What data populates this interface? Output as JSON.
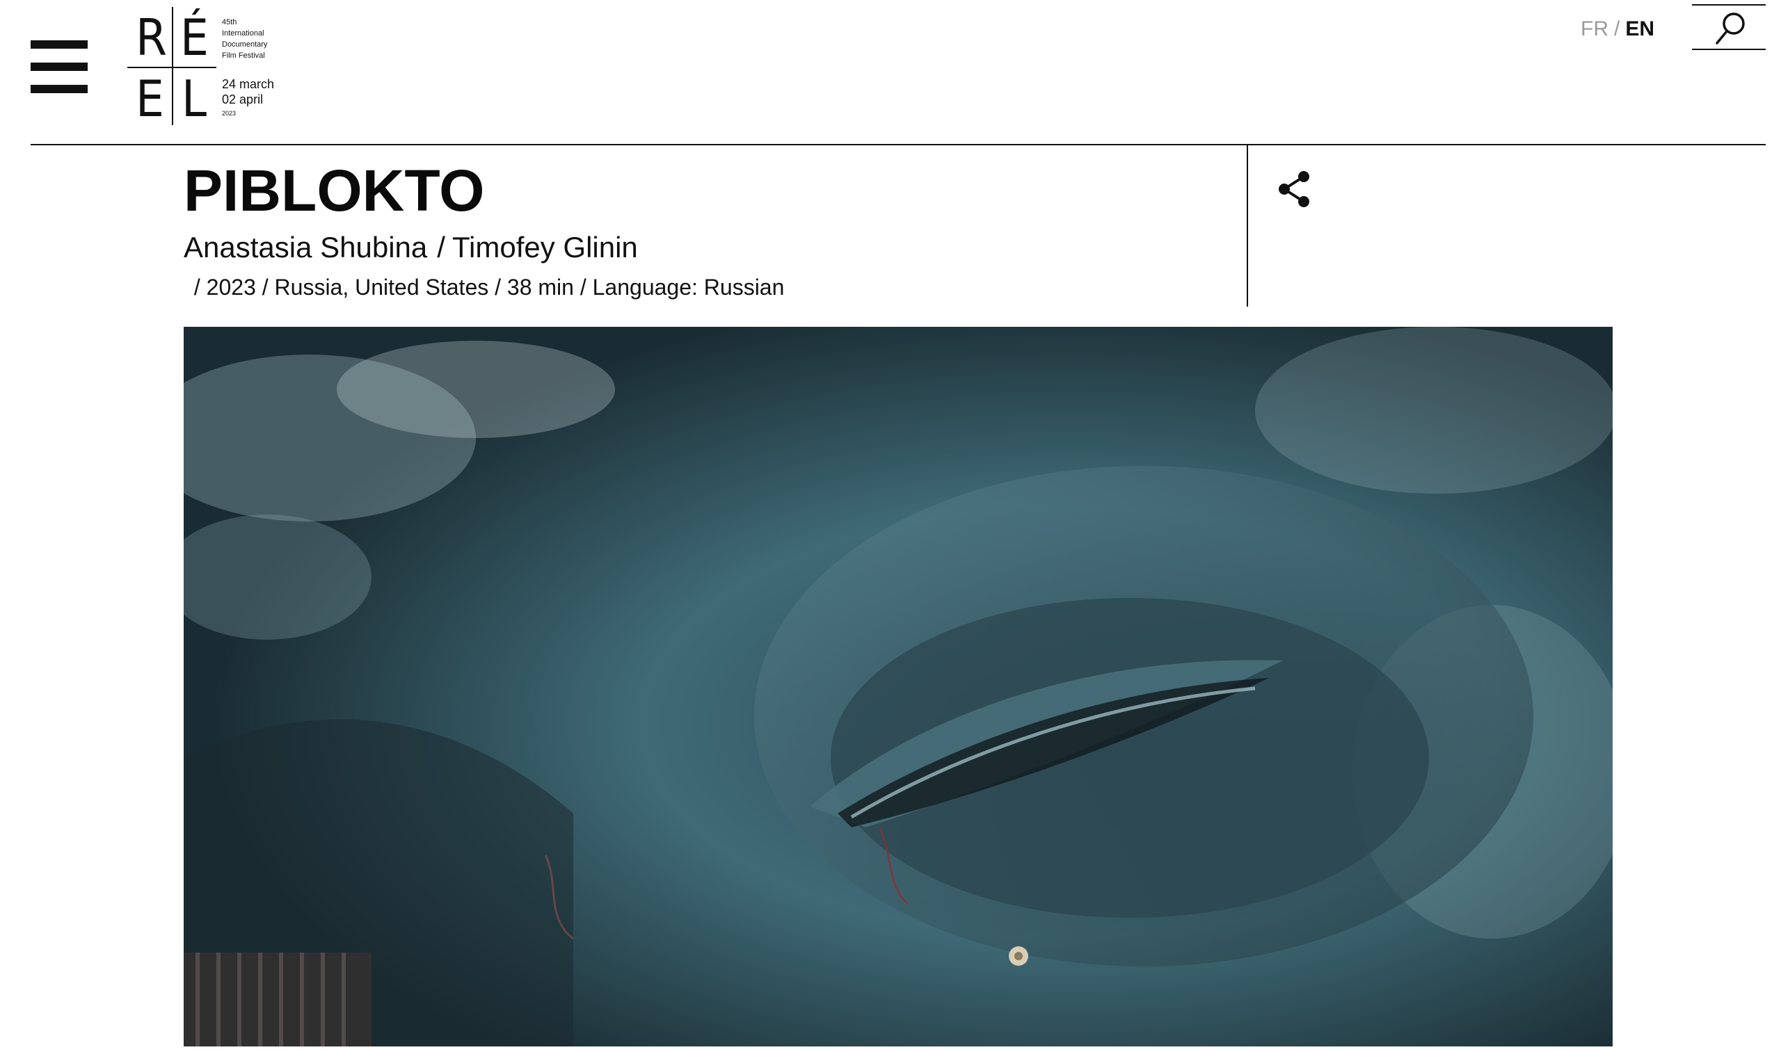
{
  "header": {
    "menu_icon": "hamburger-menu-icon",
    "logo": {
      "letters": [
        "R",
        "É",
        "E",
        "L"
      ],
      "edition": "45th",
      "subtitle_lines": [
        "International",
        "Documentary",
        "Film Festival"
      ],
      "date_line1_num": "24",
      "date_line1_word": "march",
      "date_line2_num": "02",
      "date_line2_word": "april",
      "year": "2023"
    },
    "lang": {
      "fr": "FR",
      "separator": "/",
      "en": "EN",
      "active": "EN"
    },
    "search_icon": "search-icon"
  },
  "film": {
    "title": "PIBLOKTO",
    "directors": [
      "Anastasia Shubina",
      "Timofey Glinin"
    ],
    "details": " / 2023 / Russia, United States / 38 min / Language: Russian",
    "share_icon": "share-icon",
    "hero_image": "close-up of a gray whale eye, blue-teal tones"
  },
  "colors": {
    "text": "#111111",
    "muted": "#9a9a9a",
    "background": "#ffffff"
  }
}
